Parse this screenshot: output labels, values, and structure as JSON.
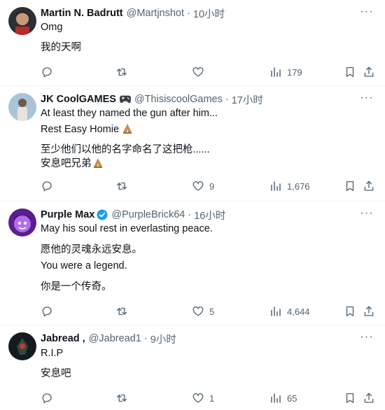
{
  "tweets": [
    {
      "name": "Martin N. Badrutt",
      "handle": "@Martjnshot",
      "time": "10小时",
      "lines": [
        "Omg",
        "我的天啊"
      ],
      "stats": {
        "reply": "",
        "retweet": "",
        "like": "",
        "views": "179"
      }
    },
    {
      "name": "JK CoolGAMES",
      "handle": "@ThisiscoolGames",
      "time": "17小时",
      "lines": [
        "At least they named the gun after him...",
        "Rest Easy Homie",
        "至少他们以他的名字命名了这把枪......",
        "安息吧兄弟"
      ],
      "stats": {
        "reply": "",
        "retweet": "",
        "like": "9",
        "views": "1,676"
      }
    },
    {
      "name": "Purple Max",
      "handle": "@PurpleBrick64",
      "time": "16小时",
      "lines": [
        "May his soul rest in everlasting peace.",
        "愿他的灵魂永远安息。",
        "You were a legend.",
        "你是一个传奇。"
      ],
      "stats": {
        "reply": "",
        "retweet": "",
        "like": "5",
        "views": "4,644"
      }
    },
    {
      "name": "Jabread ,",
      "handle": "@Jabread1",
      "time": "9小时",
      "lines": [
        "R.I.P",
        "安息吧"
      ],
      "stats": {
        "reply": "",
        "retweet": "",
        "like": "1",
        "views": "65"
      }
    }
  ],
  "colors": {
    "text": "#0f1419",
    "secondary": "#536471",
    "verified": "#1d9bf0",
    "divider": "#eff3f4"
  },
  "icons": [
    "reply-icon",
    "retweet-icon",
    "like-icon",
    "views-icon",
    "bookmark-icon",
    "share-icon",
    "more-icon",
    "verified-badge-icon",
    "gamepad-emoji",
    "folded-hands-emoji"
  ],
  "separator": "·",
  "more_label": "···"
}
